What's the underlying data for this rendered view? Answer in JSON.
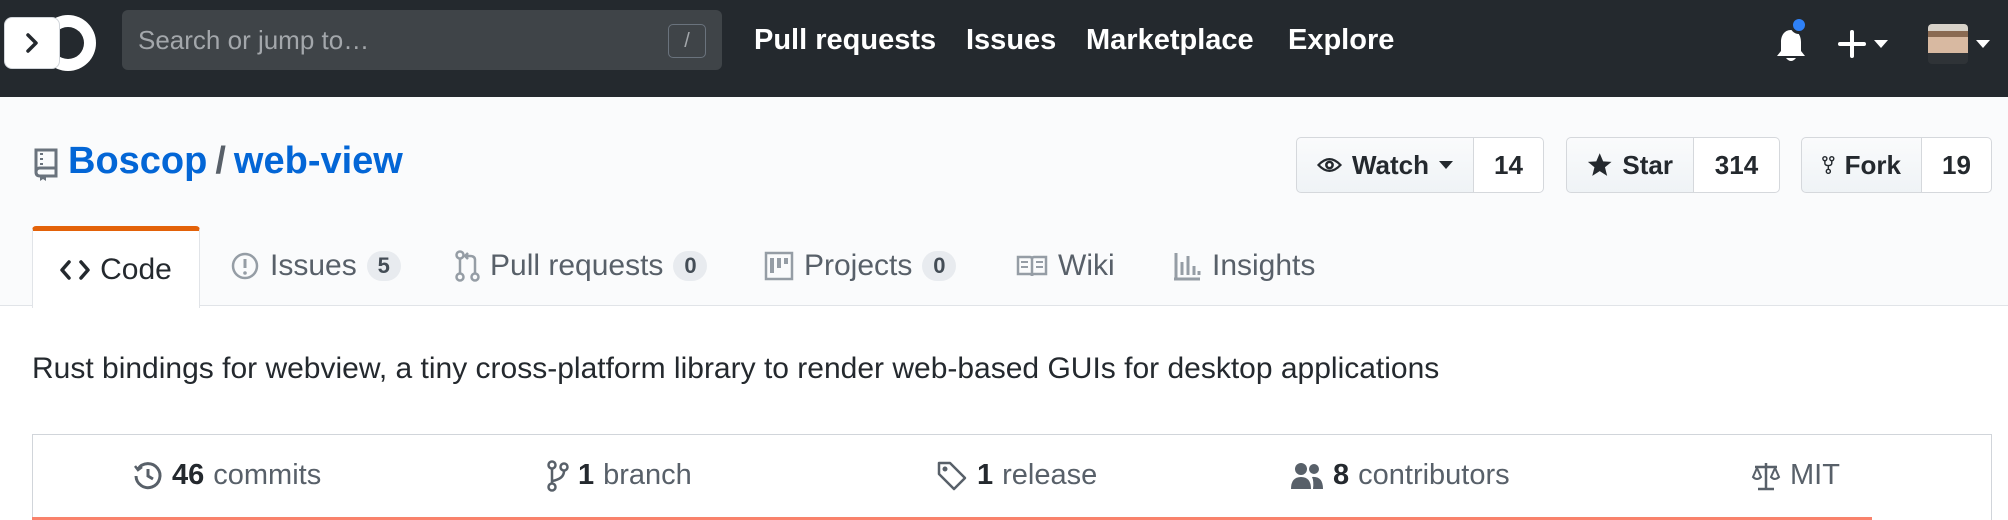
{
  "header": {
    "search": {
      "placeholder": "Search or jump to…",
      "shortcut_key": "/"
    },
    "nav": [
      "Pull requests",
      "Issues",
      "Marketplace",
      "Explore"
    ],
    "notification_unread": true,
    "icons": [
      "chevron-right-icon",
      "github-logo",
      "bell-icon",
      "plus-icon",
      "avatar"
    ]
  },
  "repo": {
    "owner": "Boscop",
    "separator": "/",
    "name": "web-view",
    "actions": {
      "watch": {
        "label": "Watch",
        "count": "14"
      },
      "star": {
        "label": "Star",
        "count": "314"
      },
      "fork": {
        "label": "Fork",
        "count": "19"
      }
    },
    "tabs": [
      {
        "label": "Code",
        "icon": "code-icon",
        "selected": true
      },
      {
        "label": "Issues",
        "count": "5",
        "icon": "issue-icon"
      },
      {
        "label": "Pull requests",
        "count": "0",
        "icon": "pull-request-icon"
      },
      {
        "label": "Projects",
        "count": "0",
        "icon": "project-icon"
      },
      {
        "label": "Wiki",
        "icon": "book-icon"
      },
      {
        "label": "Insights",
        "icon": "graph-icon"
      }
    ],
    "description": "Rust bindings for webview, a tiny cross-platform library to render web-based GUIs for desktop applications",
    "summary": [
      {
        "count": "46",
        "label": "commits",
        "icon": "history-icon"
      },
      {
        "count": "1",
        "label": "branch",
        "icon": "branch-icon"
      },
      {
        "count": "1",
        "label": "release",
        "icon": "tag-icon"
      },
      {
        "count": "8",
        "label": "contributors",
        "icon": "people-icon"
      },
      {
        "label": "MIT",
        "icon": "law-icon"
      }
    ]
  },
  "colors": {
    "header_bg": "#24292e",
    "link_blue": "#0366d6",
    "selected_tab_accent": "#e36209",
    "language_bar": "#f9826c"
  }
}
